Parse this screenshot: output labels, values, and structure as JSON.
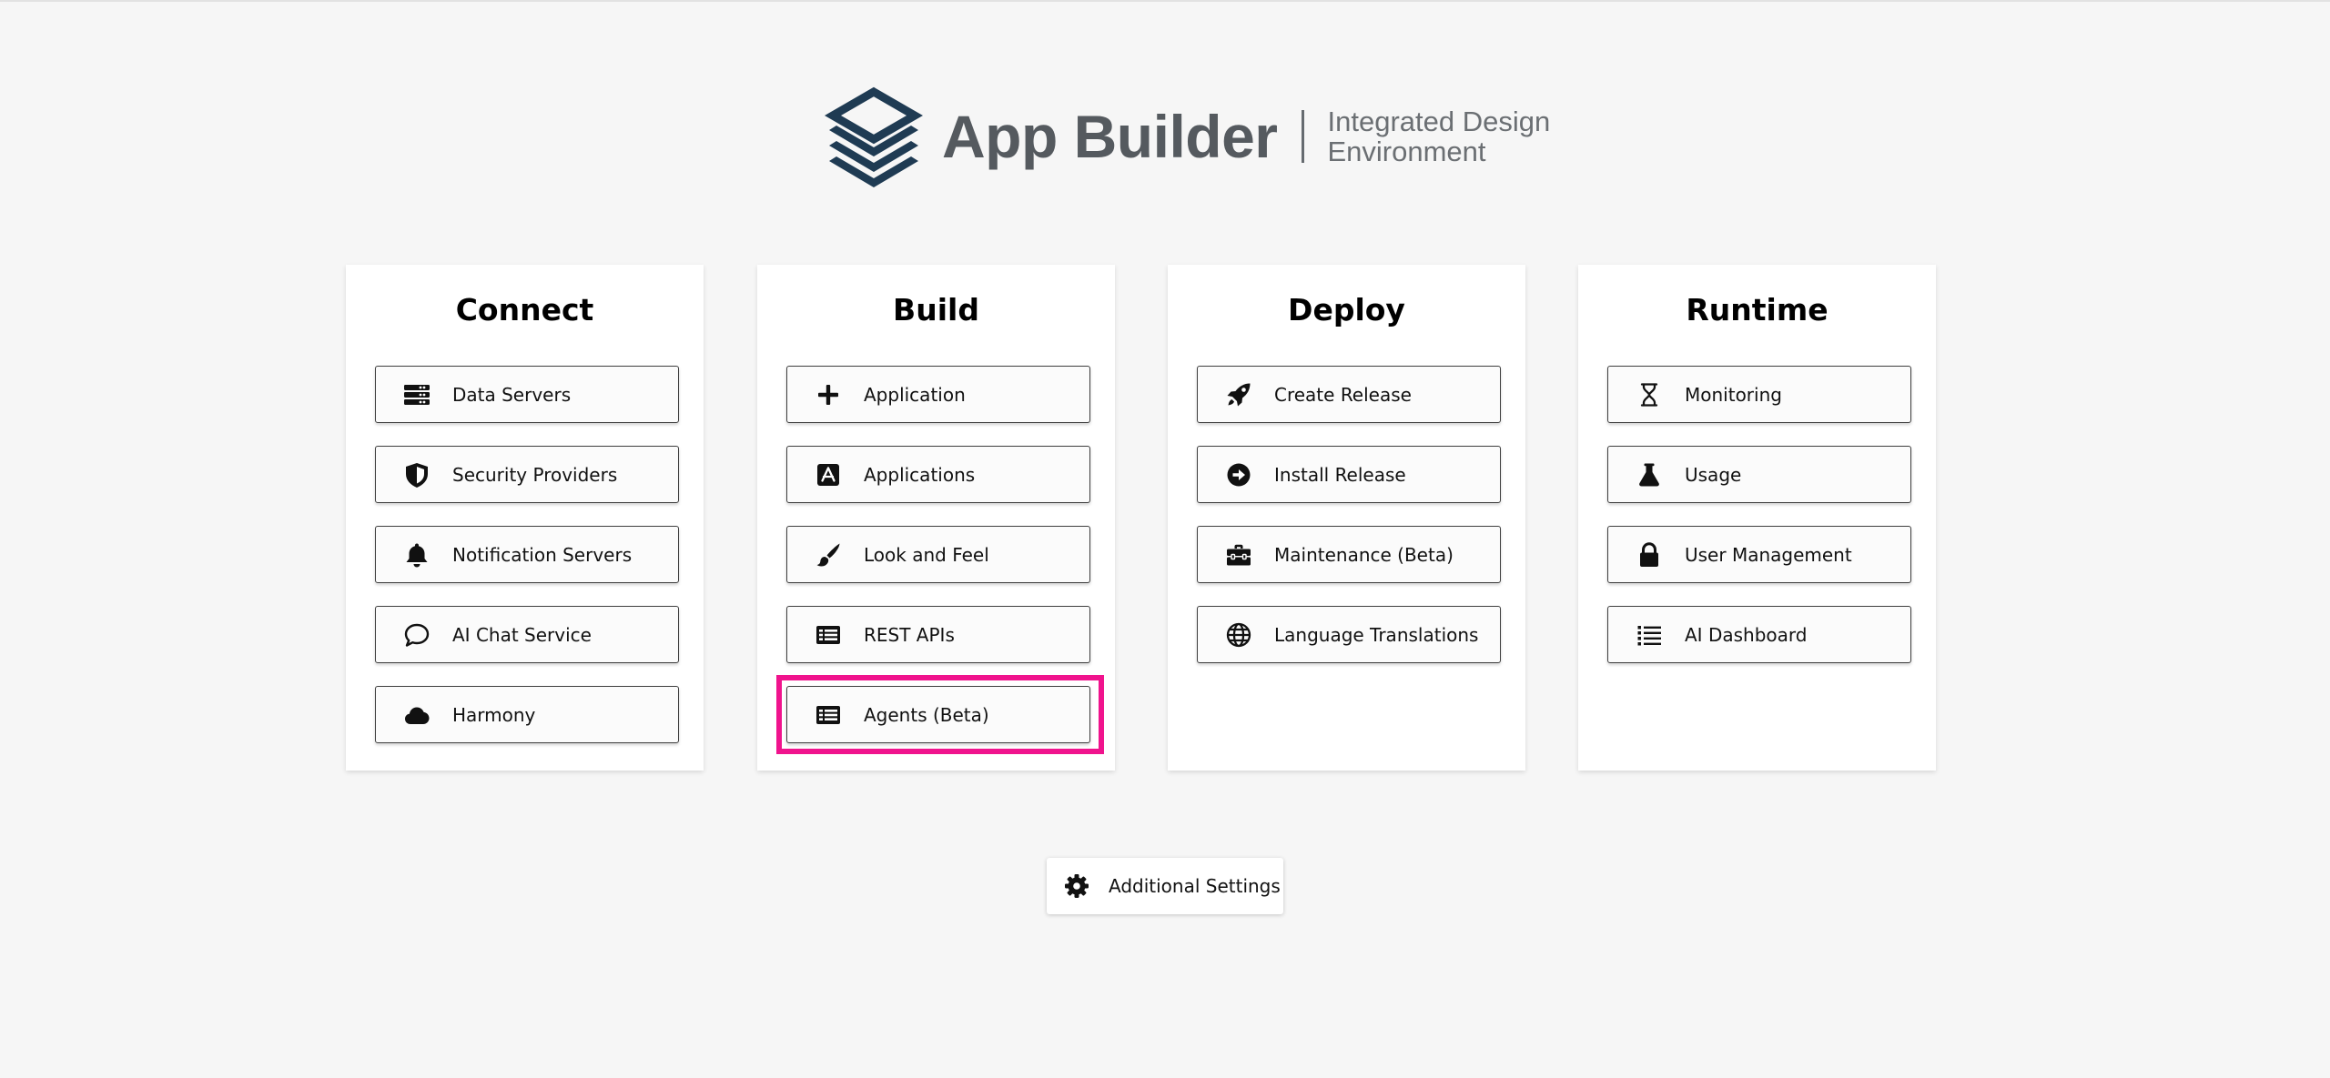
{
  "header": {
    "title": "App Builder",
    "subtitle_line1": "Integrated Design",
    "subtitle_line2": "Environment",
    "logo_icon": "layers-icon"
  },
  "colors": {
    "logo": "#1f3b53",
    "highlight": "#f0138d",
    "background": "#f6f6f6"
  },
  "columns": [
    {
      "title": "Connect",
      "items": [
        {
          "label": "Data Servers",
          "icon": "server-icon"
        },
        {
          "label": "Security Providers",
          "icon": "shield-icon"
        },
        {
          "label": "Notification Servers",
          "icon": "bell-icon"
        },
        {
          "label": "AI Chat Service",
          "icon": "chat-bubble-icon"
        },
        {
          "label": "Harmony",
          "icon": "cloud-icon"
        }
      ]
    },
    {
      "title": "Build",
      "items": [
        {
          "label": "Application",
          "icon": "plus-icon"
        },
        {
          "label": "Applications",
          "icon": "app-store-icon"
        },
        {
          "label": "Look and Feel",
          "icon": "paintbrush-icon"
        },
        {
          "label": "REST APIs",
          "icon": "list-alt-icon"
        },
        {
          "label": "Agents (Beta)",
          "icon": "list-alt-icon",
          "highlighted": true
        }
      ]
    },
    {
      "title": "Deploy",
      "items": [
        {
          "label": "Create Release",
          "icon": "rocket-icon"
        },
        {
          "label": "Install Release",
          "icon": "arrow-circle-right-icon"
        },
        {
          "label": "Maintenance (Beta)",
          "icon": "toolbox-icon"
        },
        {
          "label": "Language Translations",
          "icon": "globe-icon"
        }
      ]
    },
    {
      "title": "Runtime",
      "items": [
        {
          "label": "Monitoring",
          "icon": "hourglass-icon"
        },
        {
          "label": "Usage",
          "icon": "flask-icon"
        },
        {
          "label": "User Management",
          "icon": "lock-icon"
        },
        {
          "label": "AI Dashboard",
          "icon": "list-icon"
        }
      ]
    }
  ],
  "settings": {
    "label": "Additional Settings",
    "icon": "gear-icon"
  }
}
